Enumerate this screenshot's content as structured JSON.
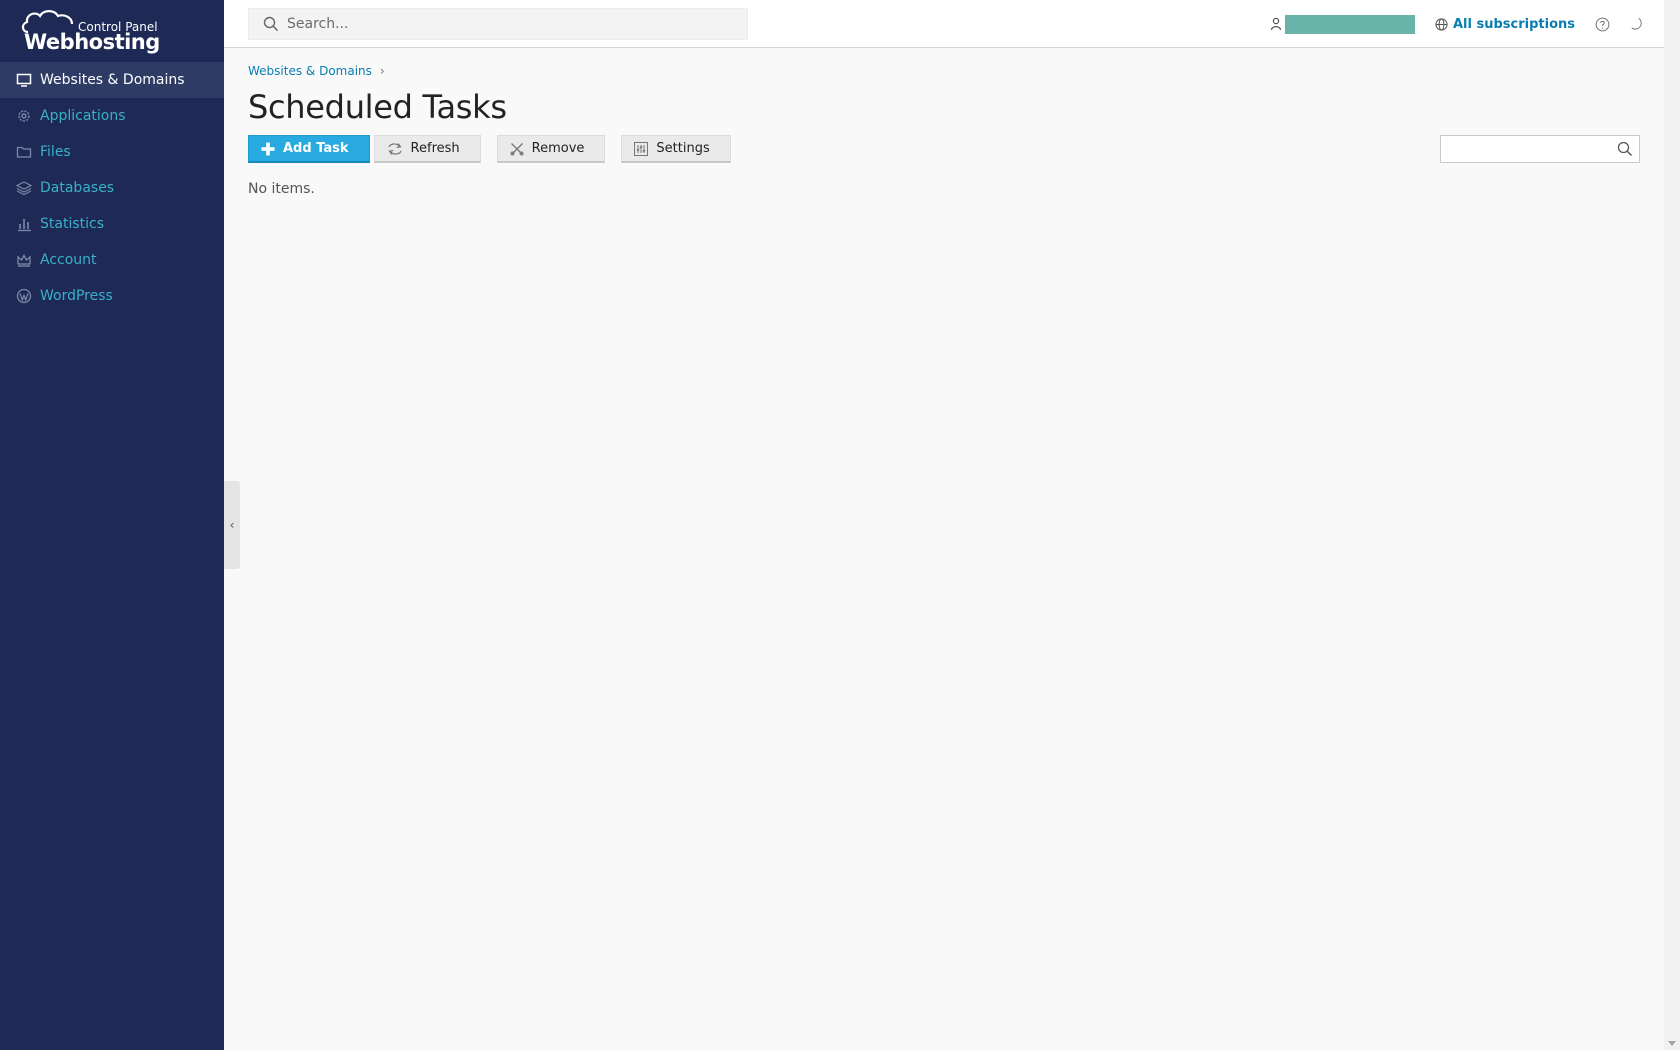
{
  "brand": {
    "small": "Control Panel",
    "big": "Webhosting"
  },
  "sidebar": {
    "items": [
      {
        "label": "Websites & Domains",
        "icon": "monitor-icon",
        "active": true
      },
      {
        "label": "Applications",
        "icon": "gear-icon",
        "active": false
      },
      {
        "label": "Files",
        "icon": "folder-icon",
        "active": false
      },
      {
        "label": "Databases",
        "icon": "layers-icon",
        "active": false
      },
      {
        "label": "Statistics",
        "icon": "bar-chart-icon",
        "active": false
      },
      {
        "label": "Account",
        "icon": "crown-icon",
        "active": false
      },
      {
        "label": "WordPress",
        "icon": "wordpress-icon",
        "active": false
      }
    ]
  },
  "header": {
    "search_placeholder": "Search...",
    "subscriptions_label": "All subscriptions"
  },
  "breadcrumb": {
    "item": "Websites & Domains",
    "separator": "›"
  },
  "page": {
    "title": "Scheduled Tasks",
    "empty_message": "No items."
  },
  "toolbar": {
    "add_label": "Add Task",
    "refresh_label": "Refresh",
    "remove_label": "Remove",
    "settings_label": "Settings"
  },
  "colors": {
    "sidebar_bg": "#1e2a55",
    "sidebar_active": "#2e3b65",
    "nav_link": "#3ab0c8",
    "primary_button": "#28aae1",
    "link": "#0a7eb0",
    "redacted_username": "#68b4a8"
  }
}
